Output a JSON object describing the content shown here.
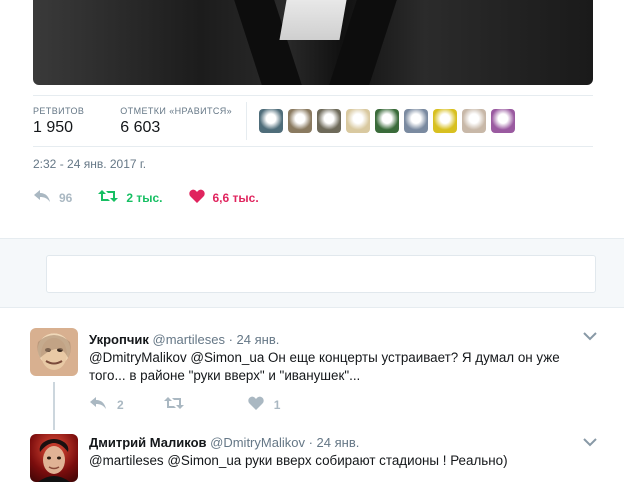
{
  "stats": {
    "retweets_label": "РЕТВИТОВ",
    "retweets_value": "1 950",
    "likes_label": "ОТМЕТКИ «НРАВИТСЯ»",
    "likes_value": "6 603",
    "liker_avatar_colors": [
      "#4f6d7a",
      "#8a7a60",
      "#6e6a5a",
      "#d9c9a0",
      "#3a6b3a",
      "#7a8aa0",
      "#d8c020",
      "#c8b8a8",
      "#9a5aa0"
    ]
  },
  "timestamp": "2:32 - 24 янв. 2017 г.",
  "actions": {
    "reply_icon": "reply-icon",
    "reply_count": "96",
    "retweet_icon": "retweet-icon",
    "retweet_count": "2 тыс.",
    "like_icon": "heart-icon",
    "like_count": "6,6 тыс."
  },
  "colors": {
    "green": "#17bf63",
    "red": "#e0245e",
    "gray": "#aab8c2"
  },
  "replies": [
    {
      "name": "Укропчик",
      "handle": "@martileses",
      "sep": "·",
      "time": "24 янв.",
      "text_line1": "@DmitryMalikov @Simon_ua Он еще концерты устраивает? Я думал он уже",
      "text_line2": "того... в районе \"руки вверх\" и \"иванушек\"...",
      "reply_count": "2",
      "retweet_count": "",
      "like_count": "1"
    },
    {
      "name": "Дмитрий Маликов",
      "handle": "@DmitryMalikov",
      "sep": "·",
      "time": "24 янв.",
      "text_line1": "@martileses @Simon_ua руки вверх собирают стадионы ! Реально)"
    }
  ]
}
